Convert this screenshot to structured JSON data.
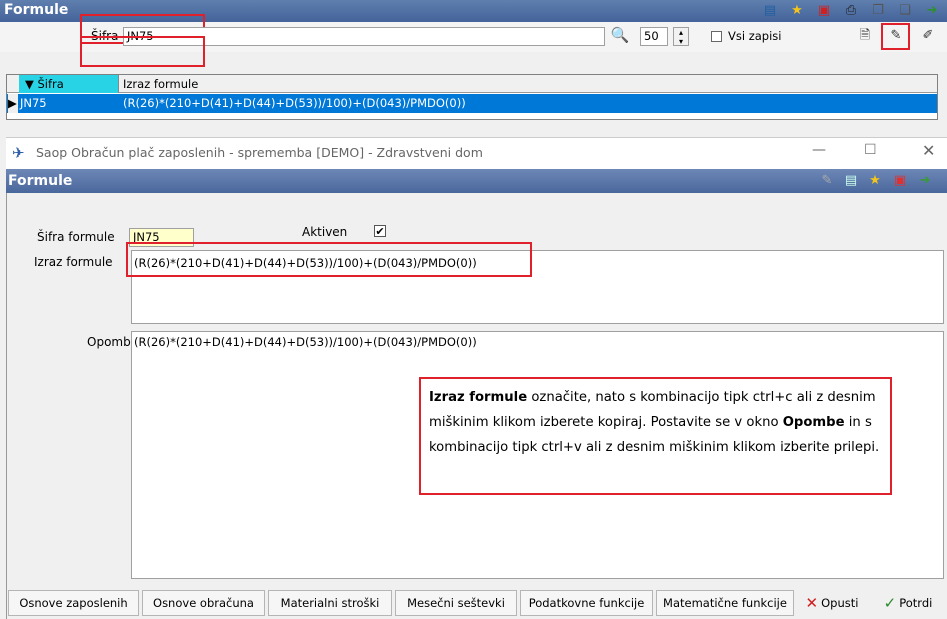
{
  "main_window": {
    "title": "Formule",
    "search": {
      "label": "Šifra",
      "value": "JN75",
      "records": "50",
      "all_records_label": "Vsi zapisi"
    },
    "grid": {
      "columns": [
        "Šifra",
        "Izraz formule"
      ],
      "rows": [
        {
          "code": "JN75",
          "formula": "(R(26)*(210+D(41)+D(44)+D(53))/100)+(D(043)/PMDO(0))"
        }
      ]
    }
  },
  "dialog": {
    "title": "Saop Obračun plač zaposlenih - sprememba [DEMO] - Zdravstveni dom",
    "section_title": "Formule",
    "code_label": "Šifra formule",
    "code_value": "JN75",
    "active_label": "Aktiven",
    "active_checked": true,
    "formula_label": "Izraz formule",
    "formula_value": "(R(26)*(210+D(41)+D(44)+D(53))/100)+(D(043)/PMDO(0))",
    "notes_label": "Opombe",
    "notes_value": "(R(26)*(210+D(41)+D(44)+D(53))/100)+(D(043)/PMDO(0))",
    "callout": {
      "bold1": "Izraz formule",
      "text1": " označite, nato s kombinacijo tipk ctrl+c ali z desnim miškinim klikom izberete kopiraj. Postavite se v okno ",
      "bold2": "Opombe",
      "text2": " in s kombinacijo tipk ctrl+v ali z desnim miškinim klikom izberite prilepi."
    },
    "buttons": {
      "employee_bases": "Osnove zaposlenih",
      "calc_bases": "Osnove obračuna",
      "material_costs": "Materialni stroški",
      "monthly_sums": "Mesečni seštevki",
      "data_functions": "Podatkovne funkcije",
      "math_functions": "Matematične funkcije",
      "cancel": "Opusti",
      "confirm": "Potrdi"
    }
  },
  "colors": {
    "title_bar": "#44639a",
    "selection": "#0078d7",
    "highlight_box": "#e0202a",
    "code_field": "#ffffcc"
  }
}
